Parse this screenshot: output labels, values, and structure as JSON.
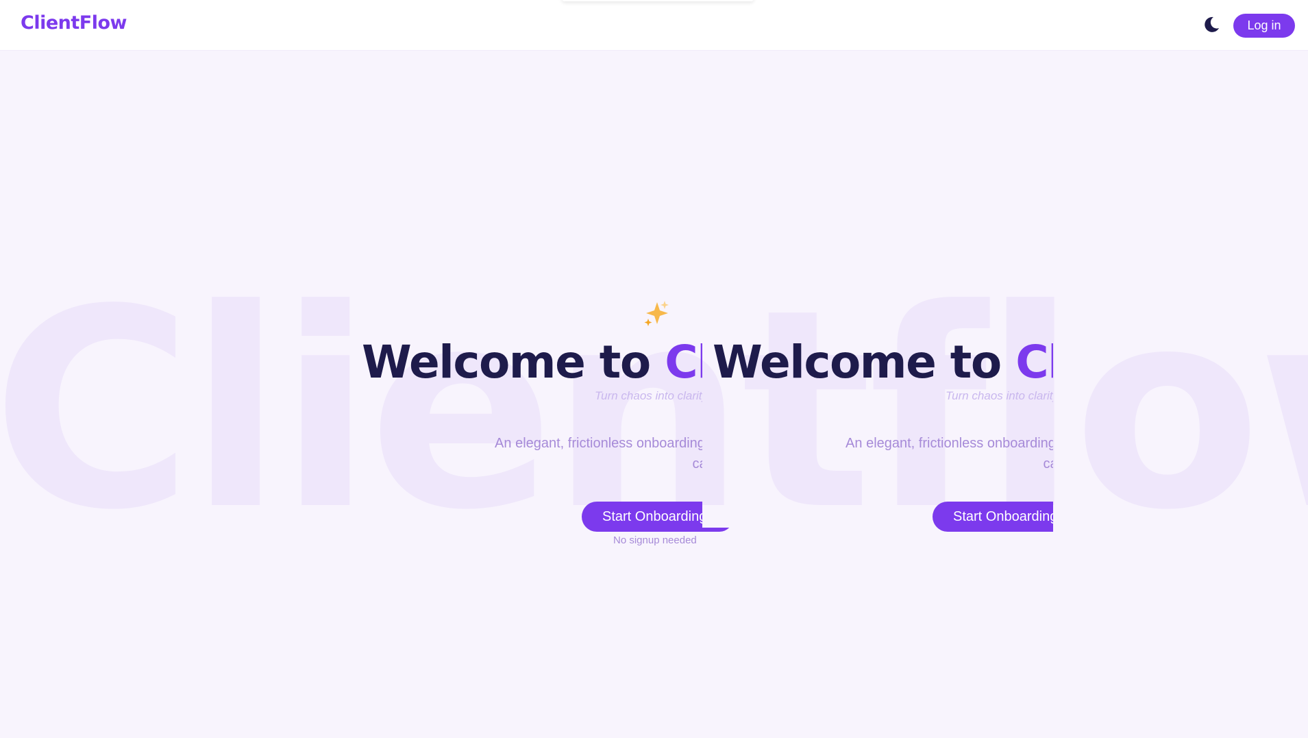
{
  "header": {
    "logo": "ClientFlow",
    "theme_toggle_icon": "moon-icon",
    "login_label": "Log in"
  },
  "hero": {
    "watermark": "Clientflow",
    "sparkle_icon": "sparkles-icon",
    "headline_prefix": "Welcome to ",
    "headline_brand": "ClientFlow",
    "tagline": "Turn chaos into clarity",
    "description": "An elegant, frictionless onboarding experience — built with clarity and care",
    "cta_label": "Start Onboarding",
    "note": "No signup needed"
  },
  "colors": {
    "accent": "#7c3aed",
    "heading": "#1e1b4b",
    "background": "#f8f4fd",
    "muted_text": "#a68ad8",
    "watermark": "#efe7fb"
  }
}
